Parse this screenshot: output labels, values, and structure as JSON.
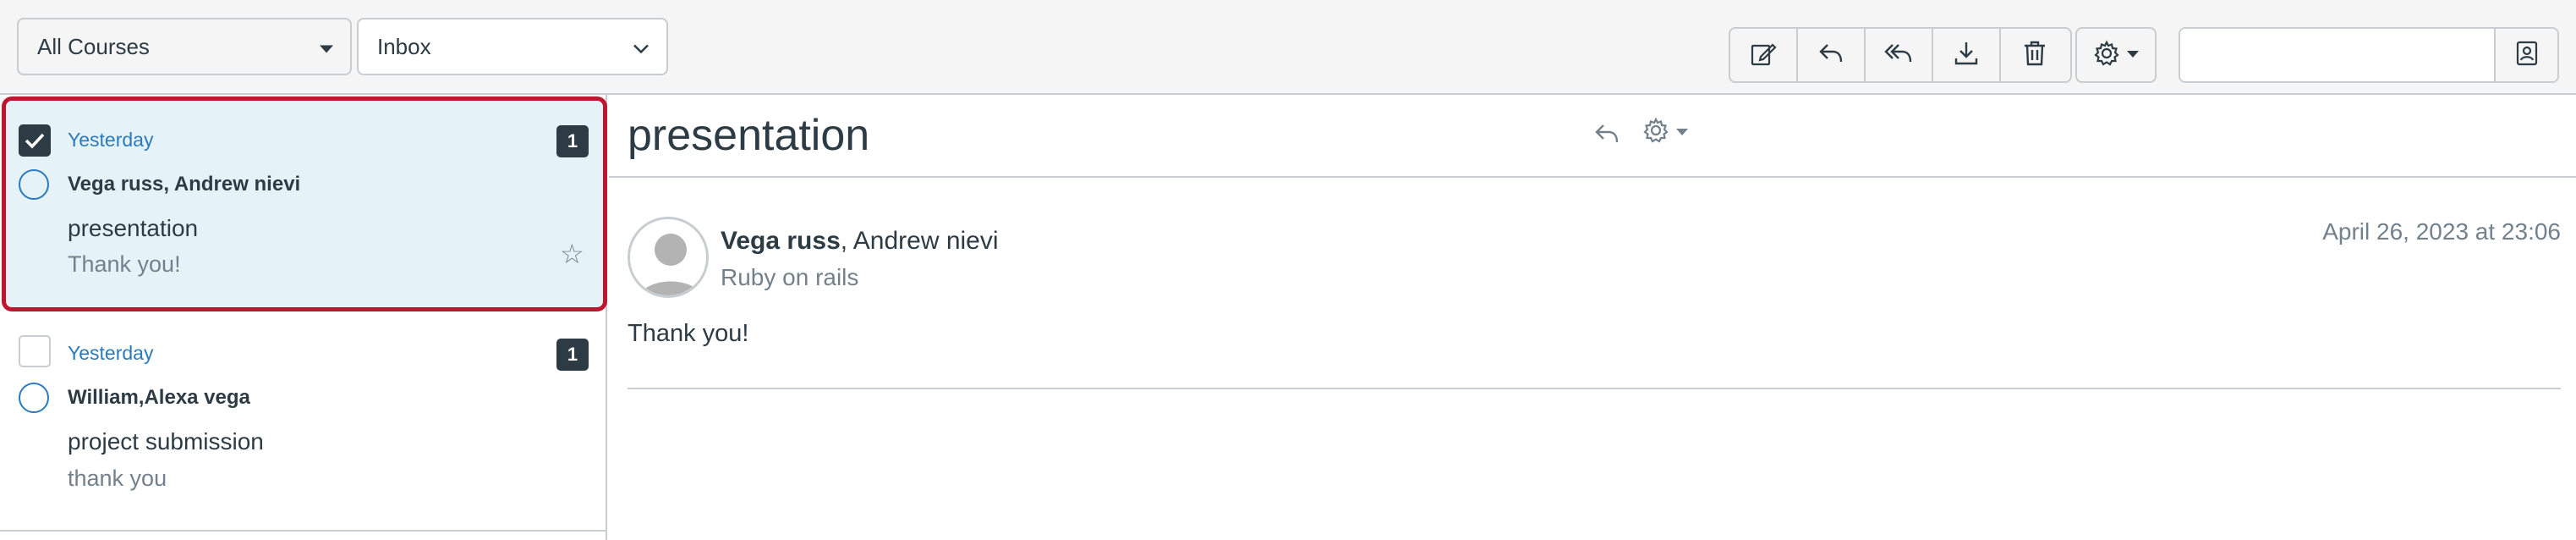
{
  "filters": {
    "course": "All Courses",
    "mailbox": "Inbox"
  },
  "toolbar": {
    "buttons": [
      "compose-icon",
      "reply-icon",
      "reply-all-icon",
      "archive-icon",
      "delete-icon",
      "gear-icon"
    ]
  },
  "search": {
    "value": "",
    "placeholder": ""
  },
  "messages": [
    {
      "date": "Yesterday",
      "participants": "Vega russ, Andrew nievi",
      "subject": "presentation",
      "preview": "Thank you!",
      "count": "1",
      "selected": true
    },
    {
      "date": "Yesterday",
      "participants": "William,Alexa vega",
      "subject": "project submission",
      "preview": "thank you",
      "count": "1",
      "selected": false
    }
  ],
  "conversation": {
    "title": "presentation",
    "author": "Vega russ",
    "others": ", Andrew nievi",
    "course": "Ruby on rails",
    "date": "April 26, 2023 at 23:06",
    "body": "Thank you!"
  },
  "colors": {
    "accent": "#2b7abc",
    "selected_bg": "#e5f2f8",
    "selected_border": "#c0152f",
    "text": "#2d3b45",
    "muted": "#73818c"
  }
}
